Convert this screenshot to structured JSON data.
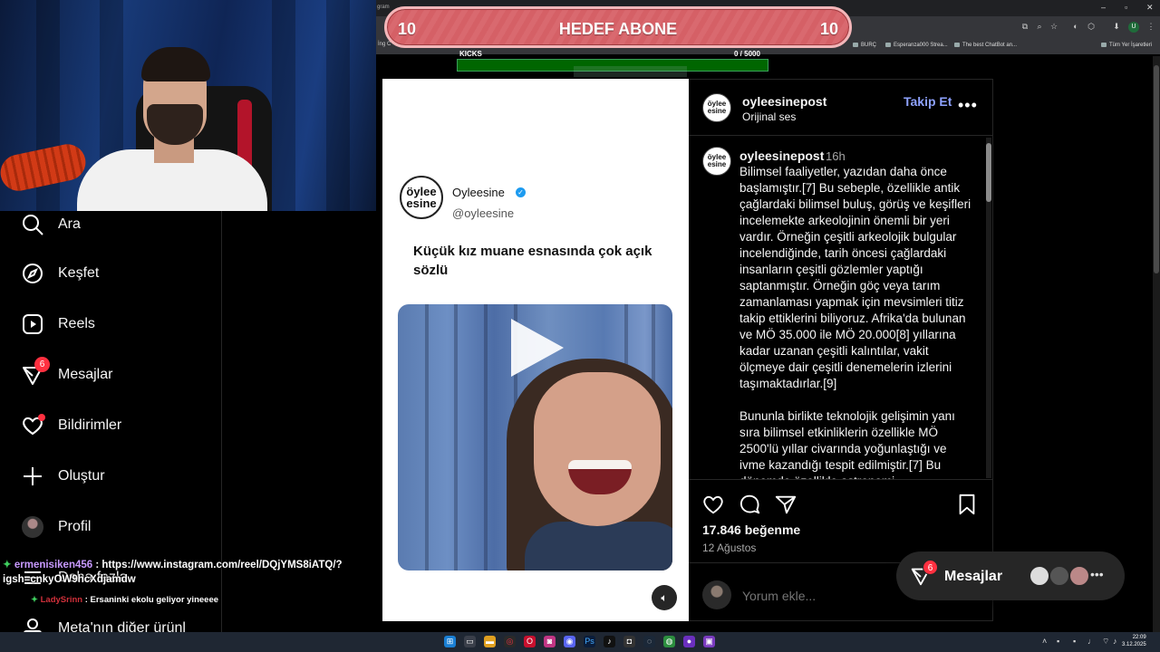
{
  "goal": {
    "left": "10",
    "title": "HEDEF ABONE",
    "right": "10"
  },
  "kicks": {
    "label": "KICKS",
    "count": "0 / 5000",
    "progress": 0
  },
  "browser": {
    "bookmarks": [
      "BURÇ",
      "Esperanza000 Strea...",
      "The best ChatBot an...",
      "Tüm Yer İşaretleri"
    ],
    "tab_fragment": "gram",
    "left_fragment": "İng C",
    "profile_initial": "U"
  },
  "sidebar": {
    "items": [
      {
        "label": "Ara",
        "icon": "search-icon"
      },
      {
        "label": "Keşfet",
        "icon": "compass-icon"
      },
      {
        "label": "Reels",
        "icon": "reels-icon"
      },
      {
        "label": "Mesajlar",
        "icon": "messenger-icon",
        "badge": "6"
      },
      {
        "label": "Bildirimler",
        "icon": "heart-icon"
      },
      {
        "label": "Oluştur",
        "icon": "plus-icon"
      },
      {
        "label": "Profil",
        "icon": "avatar"
      },
      {
        "label": "Daha fazla",
        "icon": "menu-icon"
      },
      {
        "label": "Meta'nın diğer ürünl",
        "icon": "meta-icon"
      }
    ]
  },
  "chat": {
    "line1_user": "ermenisiken456",
    "line1_text": " : https://www.instagram.com/reel/DQjYMS8iATQ/?",
    "line2_text": "igsh=cnkyOW9hcXdjamdw",
    "line3_user": "LadySrinn",
    "line3_text": " : Ersaninki ekolu geliyor yineeee"
  },
  "post": {
    "tweet": {
      "avatar_text": "öylee esine",
      "name": "Oyleesine",
      "handle": "@oyleesine",
      "text": "Küçük kız muane esnasında çok açık sözlü"
    },
    "header": {
      "username": "oyleesinepost",
      "audio": "Orijinal ses",
      "follow": "Takip Et",
      "more": "•••"
    },
    "caption": {
      "username": "oyleesinepost",
      "time": "16h",
      "text": "Bilimsel faaliyetler, yazıdan daha önce başlamıştır.[7] Bu sebeple, özellikle antik çağlardaki bilimsel buluş, görüş ve keşifleri incelemekte arkeolojinin önemli bir yeri vardır. Örneğin çeşitli arkeolojik bulgular incelendiğinde, tarih öncesi çağlardaki insanların çeşitli gözlemler yaptığı saptanmıştır. Örneğin göç veya tarım zamanlaması yapmak için mevsimleri titiz takip ettiklerini biliyoruz. Afrika'da bulunan ve MÖ 35.000 ile MÖ 20.000[8] yıllarına kadar uzanan çeşitli kalıntılar, vakit ölçmeye dair çeşitli denemelerin izlerini taşımaktadırlar.[9]\n\nBununla birlikte teknolojik gelişimin yanı sıra bilimsel etkinliklerin özellikle MÖ 2500'lü yıllar civarında yoğunlaştığı ve ivme kazandığı tespit edilmiştir.[7] Bu dönemde özellikle astronomi"
    },
    "likes": "17.846 beğenme",
    "date": "12 Ağustos",
    "comment_placeholder": "Yorum ekle..."
  },
  "messages_pill": {
    "label": "Mesajlar",
    "badge": "6"
  },
  "clock": {
    "time": "22:09",
    "date": "3.12.2025"
  },
  "colors": {
    "accent_follow": "#8ea2ff",
    "badge": "#ff3040",
    "goal": "#d9696f"
  }
}
